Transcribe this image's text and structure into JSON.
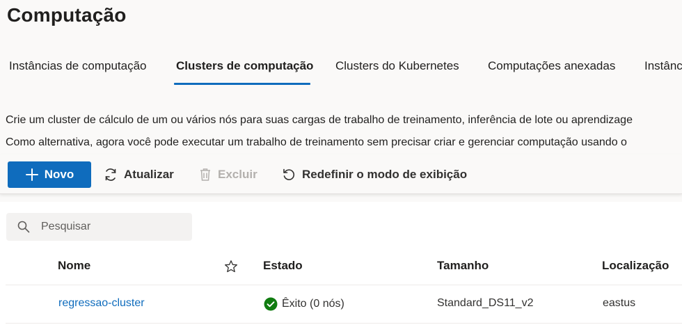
{
  "page": {
    "title": "Computação"
  },
  "tabs": [
    {
      "label": "Instâncias de computação",
      "active": false
    },
    {
      "label": "Clusters de computação",
      "active": true
    },
    {
      "label": "Clusters do Kubernetes",
      "active": false
    },
    {
      "label": "Computações anexadas",
      "active": false
    },
    {
      "label": "Instânc",
      "active": false
    }
  ],
  "description": {
    "line1": "Crie um cluster de cálculo de um ou vários nós para suas cargas de trabalho de treinamento, inferência de lote ou aprendizage",
    "line2": "Como alternativa, agora você pode executar um trabalho de treinamento sem precisar criar e gerenciar computação usando o"
  },
  "toolbar": {
    "new_label": "Novo",
    "refresh_label": "Atualizar",
    "delete_label": "Excluir",
    "reset_view_label": "Redefinir o modo de exibição"
  },
  "search": {
    "placeholder": "Pesquisar",
    "value": ""
  },
  "table": {
    "columns": [
      "Nome",
      "Estado",
      "Tamanho",
      "Localização"
    ],
    "rows": [
      {
        "name": "regressao-cluster",
        "status": "Êxito (0 nós)",
        "size": "Standard_DS11_v2",
        "location": "eastus"
      }
    ]
  },
  "colors": {
    "accent": "#0f6cbd",
    "success": "#107c10",
    "background": "#faf9f8"
  }
}
